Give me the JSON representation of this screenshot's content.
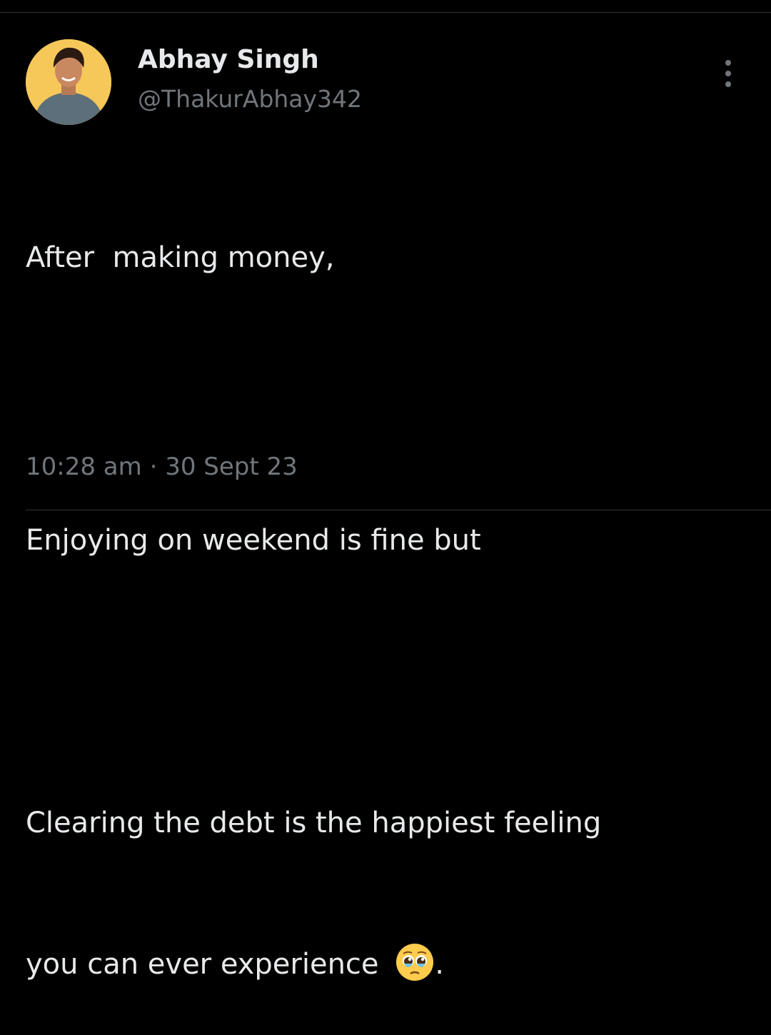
{
  "author": {
    "display_name": "Abhay Singh",
    "handle": "@ThakurAbhay342",
    "avatar_bg": "#f6c85a"
  },
  "tweet": {
    "lines": [
      "After  making money,",
      "",
      "Enjoying on weekend is fine but",
      "",
      "Clearing the debt is the happiest feeling",
      "you can ever experience "
    ],
    "trailing_punct": ".",
    "emoji_icon": "pleading-face-emoji-icon"
  },
  "meta": {
    "time": "10:28 am",
    "separator": "·",
    "date": "30 Sept 23"
  },
  "menu": {
    "icon": "more-vertical-icon"
  },
  "colors": {
    "background": "#000000",
    "primary_text": "#e7e9ea",
    "secondary_text": "#71767b",
    "divider": "#2f3336"
  }
}
